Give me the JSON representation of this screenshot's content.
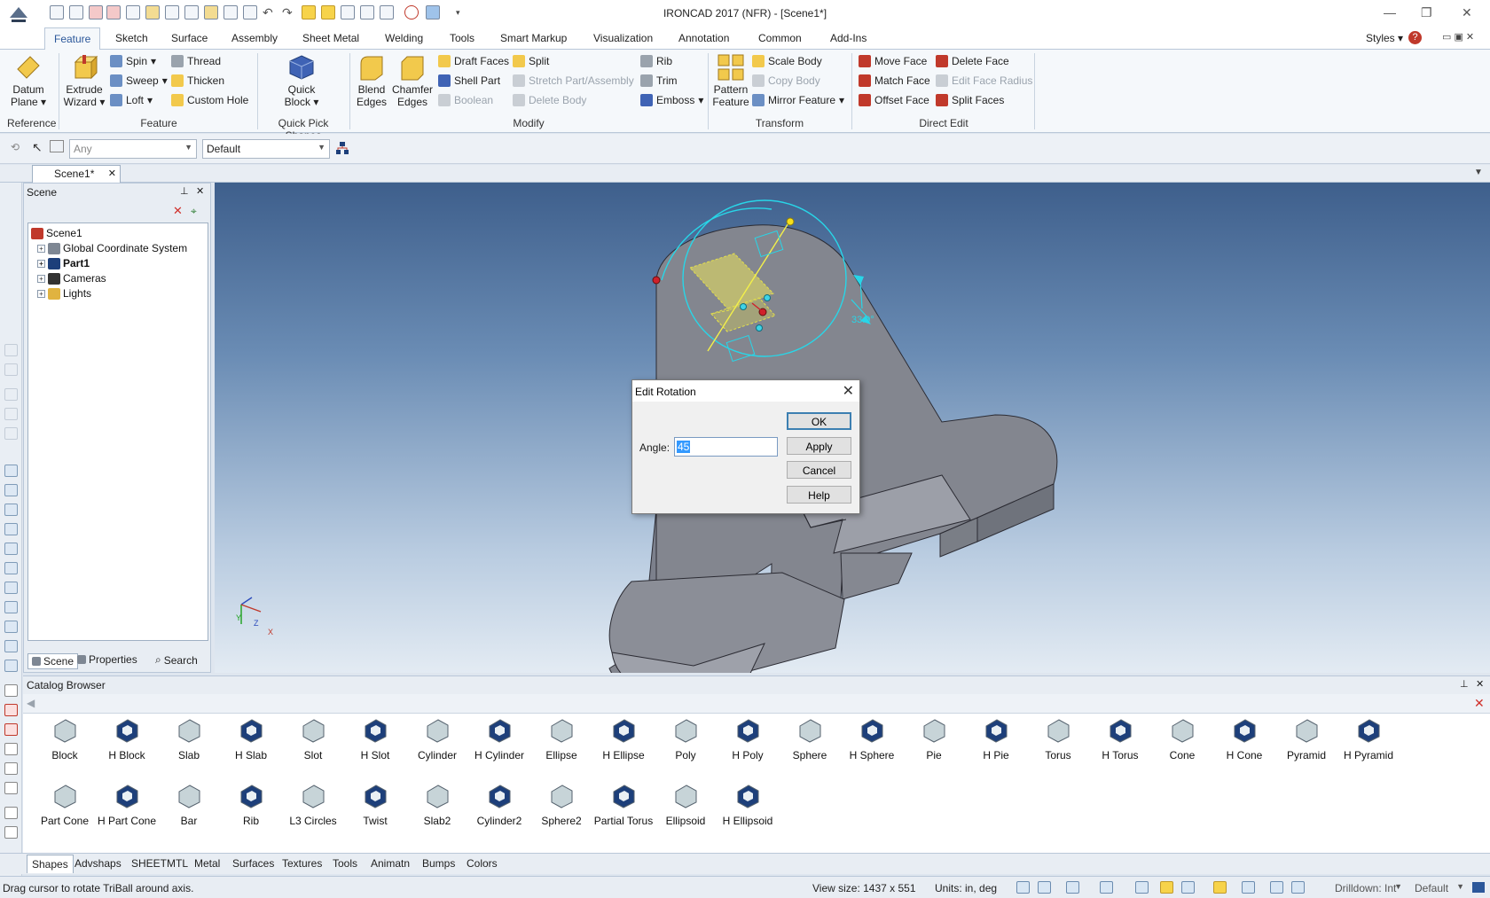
{
  "titlebar": {
    "title": "IRONCAD 2017 (NFR) - [Scene1*]",
    "minimize": "—",
    "restore": "❐",
    "close": "✕"
  },
  "menu": {
    "tabs": [
      "Feature",
      "Sketch",
      "Surface",
      "Assembly",
      "Sheet Metal",
      "Welding",
      "Tools",
      "Smart Markup",
      "Visualization",
      "Annotation",
      "Common",
      "Add-Ins"
    ],
    "styles": "Styles"
  },
  "ribbon": {
    "reference": {
      "datum_plane": "Datum Plane",
      "label": "Reference"
    },
    "feature": {
      "extrude_wizard": "Extrude Wizard",
      "spin": "Spin",
      "sweep": "Sweep",
      "loft": "Loft",
      "thread": "Thread",
      "thicken": "Thicken",
      "custom_hole": "Custom Hole",
      "label": "Feature"
    },
    "quick_pick": {
      "quick_block": "Quick Block",
      "label": "Quick Pick Shapes"
    },
    "modify": {
      "blend_edges": "Blend Edges",
      "chamfer_edges": "Chamfer Edges",
      "draft_faces": "Draft Faces",
      "shell_part": "Shell Part",
      "boolean": "Boolean",
      "split": "Split",
      "stretch": "Stretch Part/Assembly",
      "delete_body": "Delete Body",
      "rib": "Rib",
      "trim": "Trim",
      "emboss": "Emboss",
      "label": "Modify"
    },
    "transform": {
      "pattern_feature": "Pattern Feature",
      "scale_body": "Scale Body",
      "copy_body": "Copy Body",
      "mirror_feature": "Mirror Feature",
      "label": "Transform"
    },
    "direct_edit": {
      "move_face": "Move Face",
      "match_face": "Match Face",
      "offset_face": "Offset Face",
      "delete_face": "Delete Face",
      "edit_face_radius": "Edit Face Radius",
      "split_faces": "Split Faces",
      "label": "Direct Edit"
    }
  },
  "selbar": {
    "filter": "Any",
    "style": "Default"
  },
  "doc_tab": "Scene1*",
  "scene_panel": {
    "title": "Scene",
    "tree": [
      "Scene1",
      "Global Coordinate System",
      "Part1",
      "Cameras",
      "Lights"
    ],
    "tabs": [
      "Scene",
      "Properties",
      "Search"
    ]
  },
  "viewport": {
    "angle_readout": "33.9°",
    "axis_y": "Y",
    "axis_z": "Z",
    "axis_x": "X"
  },
  "dialog": {
    "title": "Edit Rotation",
    "angle_label": "Angle:",
    "angle_value": "45",
    "ok": "OK",
    "apply": "Apply",
    "cancel": "Cancel",
    "help": "Help"
  },
  "catalog": {
    "title": "Catalog Browser",
    "row1": [
      "Block",
      "H Block",
      "Slab",
      "H Slab",
      "Slot",
      "H Slot",
      "Cylinder",
      "H Cylinder",
      "Ellipse",
      "H Ellipse",
      "Poly",
      "H Poly",
      "Sphere",
      "H Sphere",
      "Pie",
      "H Pie",
      "Torus",
      "H Torus",
      "Cone",
      "H Cone",
      "Pyramid",
      "H Pyramid"
    ],
    "row2": [
      "Part Cone",
      "H Part Cone",
      "Bar",
      "Rib",
      "L3 Circles",
      "Twist",
      "Slab2",
      "Cylinder2",
      "Sphere2",
      "Partial Torus",
      "Ellipsoid",
      "H Ellipsoid"
    ],
    "tabs": [
      "Shapes",
      "Advshaps",
      "SHEETMTL",
      "Metal",
      "Surfaces",
      "Textures",
      "Tools",
      "Animatn",
      "Bumps",
      "Colors"
    ]
  },
  "status": {
    "message": "Drag cursor to rotate TriBall around axis.",
    "view_size": "View size: 1437 x  551",
    "units": "Units: in, deg",
    "drilldown": "Drilldown: Int",
    "style": "Default"
  }
}
